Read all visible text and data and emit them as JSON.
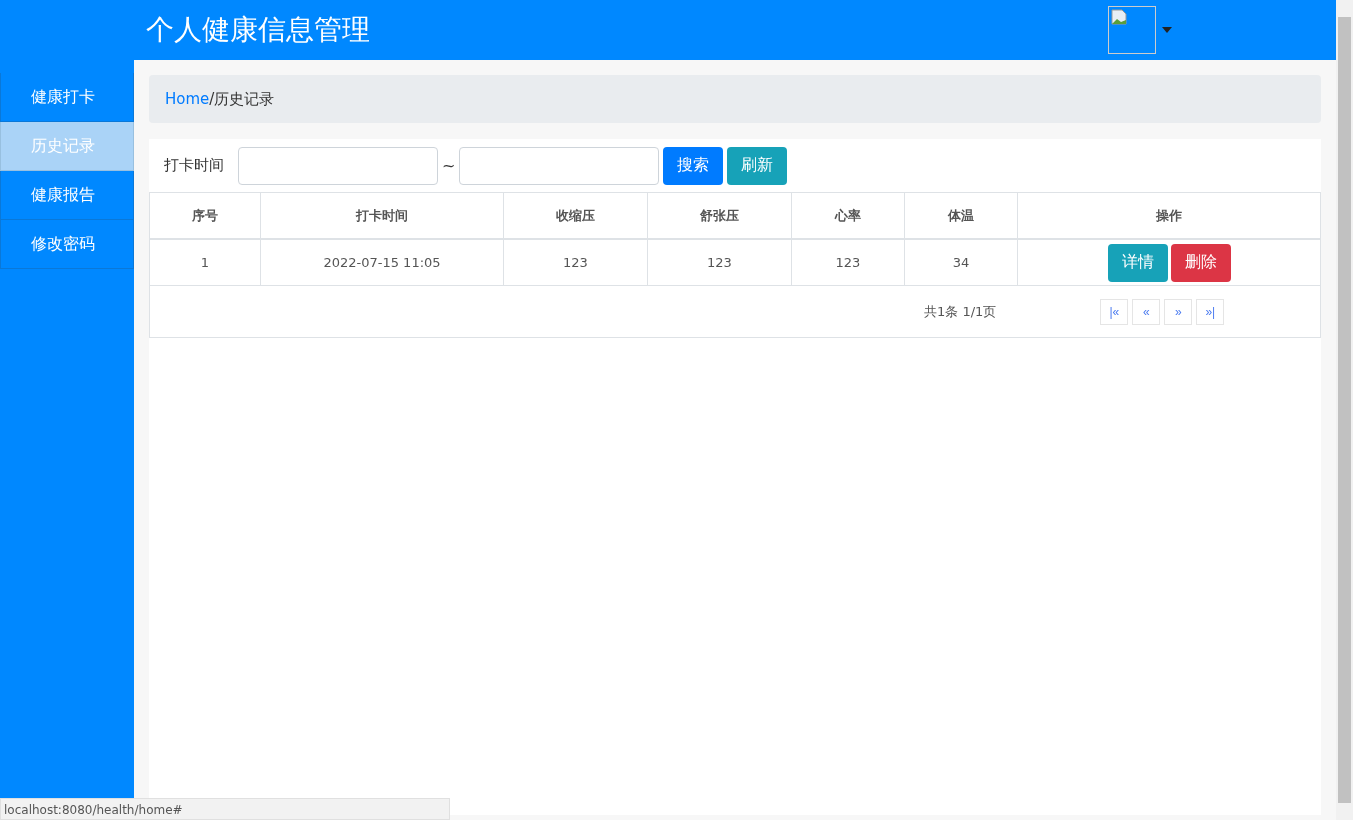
{
  "header": {
    "title": "个人健康信息管理"
  },
  "sidebar": {
    "items": [
      {
        "label": "健康打卡",
        "selected": false
      },
      {
        "label": "历史记录",
        "selected": true
      },
      {
        "label": "健康报告",
        "selected": false
      },
      {
        "label": "修改密码",
        "selected": false
      }
    ]
  },
  "breadcrumb": {
    "home": "Home",
    "separator": "/",
    "current": "历史记录"
  },
  "filter": {
    "label": "打卡时间",
    "separator": "~",
    "search_button": "搜索",
    "refresh_button": "刷新"
  },
  "table": {
    "columns": [
      "序号",
      "打卡时间",
      "收缩压",
      "舒张压",
      "心率",
      "体温",
      "操作"
    ],
    "rows": [
      {
        "cells": [
          "1",
          "2022-07-15 11:05",
          "123",
          "123",
          "123",
          "34"
        ],
        "actions": [
          "详情",
          "删除"
        ]
      }
    ]
  },
  "pagination": {
    "summary": "共1条 1/1页",
    "buttons": [
      "|«",
      "«",
      "»",
      "»|"
    ]
  },
  "status_bar": {
    "url": "localhost:8080/health/home#"
  }
}
